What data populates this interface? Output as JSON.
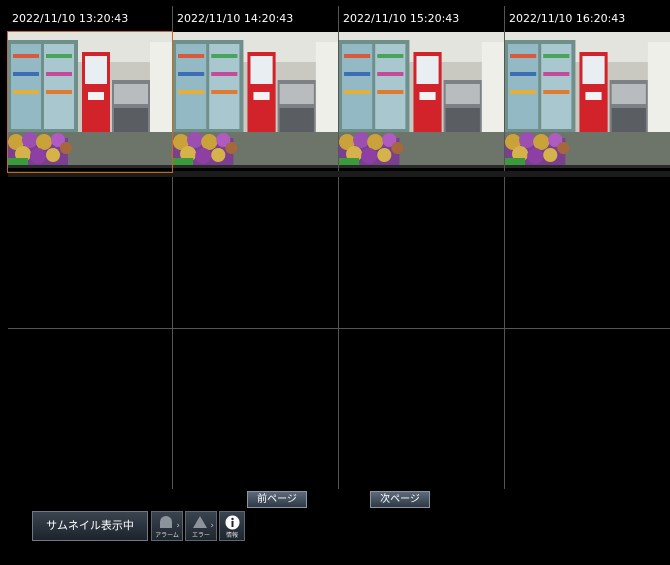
{
  "tiles": [
    {
      "timestamp": "2022/11/10 13:20:43",
      "selected": true
    },
    {
      "timestamp": "2022/11/10 14:20:43",
      "selected": false
    },
    {
      "timestamp": "2022/11/10 15:20:43",
      "selected": false
    },
    {
      "timestamp": "2022/11/10 16:20:43",
      "selected": false
    }
  ],
  "pager": {
    "prev_label": "前ページ",
    "next_label": "次ページ"
  },
  "controls": {
    "thumbnail_status": "サムネイル表示中",
    "alarm_label": "アラーム",
    "error_label": "エラー",
    "info_label": "情報"
  },
  "colors": {
    "selected_border": "#c66a1a",
    "grid_line": "#555555"
  }
}
